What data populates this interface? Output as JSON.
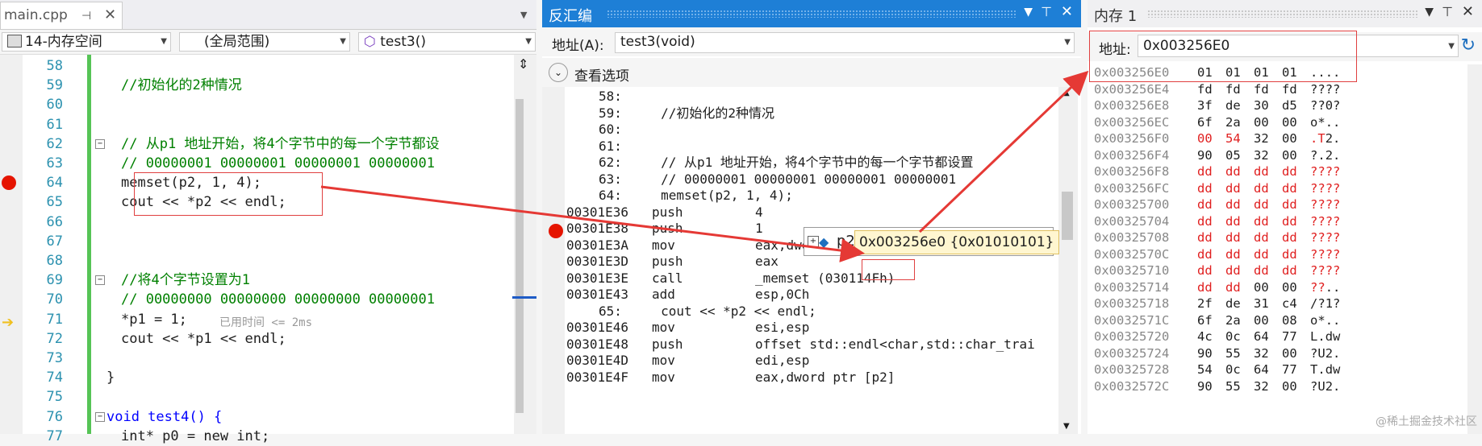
{
  "editor": {
    "tab_title": "main.cpp",
    "pin_icon": "pin-icon",
    "close_icon": "close-icon",
    "project_combo": "14-内存空间",
    "scope_combo": "(全局范围)",
    "function_combo": "test3()",
    "lines": [
      {
        "n": "58",
        "text": ""
      },
      {
        "n": "59",
        "text": "//初始化的2种情况",
        "cls": "cm"
      },
      {
        "n": "60",
        "text": ""
      },
      {
        "n": "61",
        "text": ""
      },
      {
        "n": "62",
        "text": "// 从p1 地址开始，将4个字节中的每一个字节都设",
        "cls": "cm"
      },
      {
        "n": "63",
        "text": "// 00000001 00000001 00000001 00000001",
        "cls": "cm"
      },
      {
        "n": "64",
        "text": "memset(p2, 1, 4);"
      },
      {
        "n": "65",
        "text": "cout << *p2 << endl;"
      },
      {
        "n": "66",
        "text": ""
      },
      {
        "n": "67",
        "text": ""
      },
      {
        "n": "68",
        "text": ""
      },
      {
        "n": "69",
        "text": "//将4个字节设置为1",
        "cls": "cm"
      },
      {
        "n": "70",
        "text": "// 00000000 00000000 00000000 00000001",
        "cls": "cm"
      },
      {
        "n": "71",
        "text": "*p1 = 1;"
      },
      {
        "n": "72",
        "text": "cout << *p1 << endl;"
      },
      {
        "n": "73",
        "text": ""
      },
      {
        "n": "74",
        "text": "}"
      },
      {
        "n": "75",
        "text": ""
      },
      {
        "n": "76",
        "text": "void test4() {"
      },
      {
        "n": "77",
        "text": "int* p0 = new int;"
      }
    ],
    "elapsed_hint": "已用时间 <= 2ms"
  },
  "disasm": {
    "title": "反汇编",
    "address_label": "地址(A):",
    "address_value": "test3(void)",
    "view_options": "查看选项",
    "lines": [
      {
        "t": "58:",
        "kind": "src"
      },
      {
        "t": "59:     //初始化的2种情况",
        "kind": "src"
      },
      {
        "t": "60:",
        "kind": "src"
      },
      {
        "t": "61:",
        "kind": "src"
      },
      {
        "t": "62:     // 从p1 地址开始，将4个字节中的每一个字节都设置",
        "kind": "src"
      },
      {
        "t": "63:     // 00000001 00000001 00000001 00000001",
        "kind": "src"
      },
      {
        "t": "64:     memset(p2, 1, 4);",
        "kind": "src"
      },
      {
        "addr": "00301E36",
        "op": "push",
        "arg": "4",
        "kind": "asm"
      },
      {
        "addr": "00301E38",
        "op": "push",
        "arg": "1",
        "kind": "asm"
      },
      {
        "addr": "00301E3A",
        "op": "mov",
        "arg": "eax,dword ptr [p2]",
        "kind": "asm"
      },
      {
        "addr": "00301E3D",
        "op": "push",
        "arg": "eax",
        "kind": "asm"
      },
      {
        "addr": "00301E3E",
        "op": "call",
        "arg": "_memset (030114Fh)",
        "kind": "asm"
      },
      {
        "addr": "00301E43",
        "op": "add",
        "arg": "esp,0Ch",
        "kind": "asm"
      },
      {
        "t": "65:     cout << *p2 << endl;",
        "kind": "src"
      },
      {
        "addr": "00301E46",
        "op": "mov",
        "arg": "esi,esp",
        "kind": "asm"
      },
      {
        "addr": "00301E48",
        "op": "push",
        "arg": "offset std::endl<char,std::char_trai",
        "kind": "asm"
      },
      {
        "addr": "00301E4D",
        "op": "mov",
        "arg": "edi,esp",
        "kind": "asm"
      },
      {
        "addr": "00301E4F",
        "op": "mov",
        "arg": "eax,dword ptr [p2]",
        "kind": "asm"
      }
    ],
    "tooltip_name": "p2",
    "tooltip_value": "0x003256e0 {0x01010101}"
  },
  "memory": {
    "title": "内存 1",
    "address_label": "地址:",
    "address_value": "0x003256E0",
    "rows": [
      {
        "a": "0x003256E0",
        "b": [
          "01",
          "01",
          "01",
          "01"
        ],
        "c": "....",
        "hl": []
      },
      {
        "a": "0x003256E4",
        "b": [
          "fd",
          "fd",
          "fd",
          "fd"
        ],
        "c": "????",
        "hl": []
      },
      {
        "a": "0x003256E8",
        "b": [
          "3f",
          "de",
          "30",
          "d5"
        ],
        "c": "??0?",
        "hl": []
      },
      {
        "a": "0x003256EC",
        "b": [
          "6f",
          "2a",
          "00",
          "00"
        ],
        "c": "o*..",
        "hl": []
      },
      {
        "a": "0x003256F0",
        "b": [
          "00",
          "54",
          "32",
          "00"
        ],
        "c": ".T2.",
        "hl": [
          0,
          1
        ],
        "chl": [
          0,
          1
        ]
      },
      {
        "a": "0x003256F4",
        "b": [
          "90",
          "05",
          "32",
          "00"
        ],
        "c": "?.2.",
        "hl": []
      },
      {
        "a": "0x003256F8",
        "b": [
          "dd",
          "dd",
          "dd",
          "dd"
        ],
        "c": "????",
        "hl": [
          0,
          1,
          2,
          3
        ],
        "chl": [
          0,
          1,
          2,
          3
        ]
      },
      {
        "a": "0x003256FC",
        "b": [
          "dd",
          "dd",
          "dd",
          "dd"
        ],
        "c": "????",
        "hl": [
          0,
          1,
          2,
          3
        ],
        "chl": [
          0,
          1,
          2,
          3
        ]
      },
      {
        "a": "0x00325700",
        "b": [
          "dd",
          "dd",
          "dd",
          "dd"
        ],
        "c": "????",
        "hl": [
          0,
          1,
          2,
          3
        ],
        "chl": [
          0,
          1,
          2,
          3
        ]
      },
      {
        "a": "0x00325704",
        "b": [
          "dd",
          "dd",
          "dd",
          "dd"
        ],
        "c": "????",
        "hl": [
          0,
          1,
          2,
          3
        ],
        "chl": [
          0,
          1,
          2,
          3
        ]
      },
      {
        "a": "0x00325708",
        "b": [
          "dd",
          "dd",
          "dd",
          "dd"
        ],
        "c": "????",
        "hl": [
          0,
          1,
          2,
          3
        ],
        "chl": [
          0,
          1,
          2,
          3
        ]
      },
      {
        "a": "0x0032570C",
        "b": [
          "dd",
          "dd",
          "dd",
          "dd"
        ],
        "c": "????",
        "hl": [
          0,
          1,
          2,
          3
        ],
        "chl": [
          0,
          1,
          2,
          3
        ]
      },
      {
        "a": "0x00325710",
        "b": [
          "dd",
          "dd",
          "dd",
          "dd"
        ],
        "c": "????",
        "hl": [
          0,
          1,
          2,
          3
        ],
        "chl": [
          0,
          1,
          2,
          3
        ]
      },
      {
        "a": "0x00325714",
        "b": [
          "dd",
          "dd",
          "00",
          "00"
        ],
        "c": "??..",
        "hl": [
          0,
          1
        ],
        "chl": [
          0,
          1
        ]
      },
      {
        "a": "0x00325718",
        "b": [
          "2f",
          "de",
          "31",
          "c4"
        ],
        "c": "/?1?",
        "hl": []
      },
      {
        "a": "0x0032571C",
        "b": [
          "6f",
          "2a",
          "00",
          "08"
        ],
        "c": "o*..",
        "hl": []
      },
      {
        "a": "0x00325720",
        "b": [
          "4c",
          "0c",
          "64",
          "77"
        ],
        "c": "L.dw",
        "hl": []
      },
      {
        "a": "0x00325724",
        "b": [
          "90",
          "55",
          "32",
          "00"
        ],
        "c": "?U2.",
        "hl": []
      },
      {
        "a": "0x00325728",
        "b": [
          "54",
          "0c",
          "64",
          "77"
        ],
        "c": "T.dw",
        "hl": []
      },
      {
        "a": "0x0032572C",
        "b": [
          "90",
          "55",
          "32",
          "00"
        ],
        "c": "?U2.",
        "hl": []
      }
    ]
  },
  "watermark": "@稀土掘金技术社区",
  "colors": {
    "accent": "#1e7fd6",
    "annotation": "#e53935",
    "line_number": "#2b91af",
    "comment": "#008000"
  }
}
